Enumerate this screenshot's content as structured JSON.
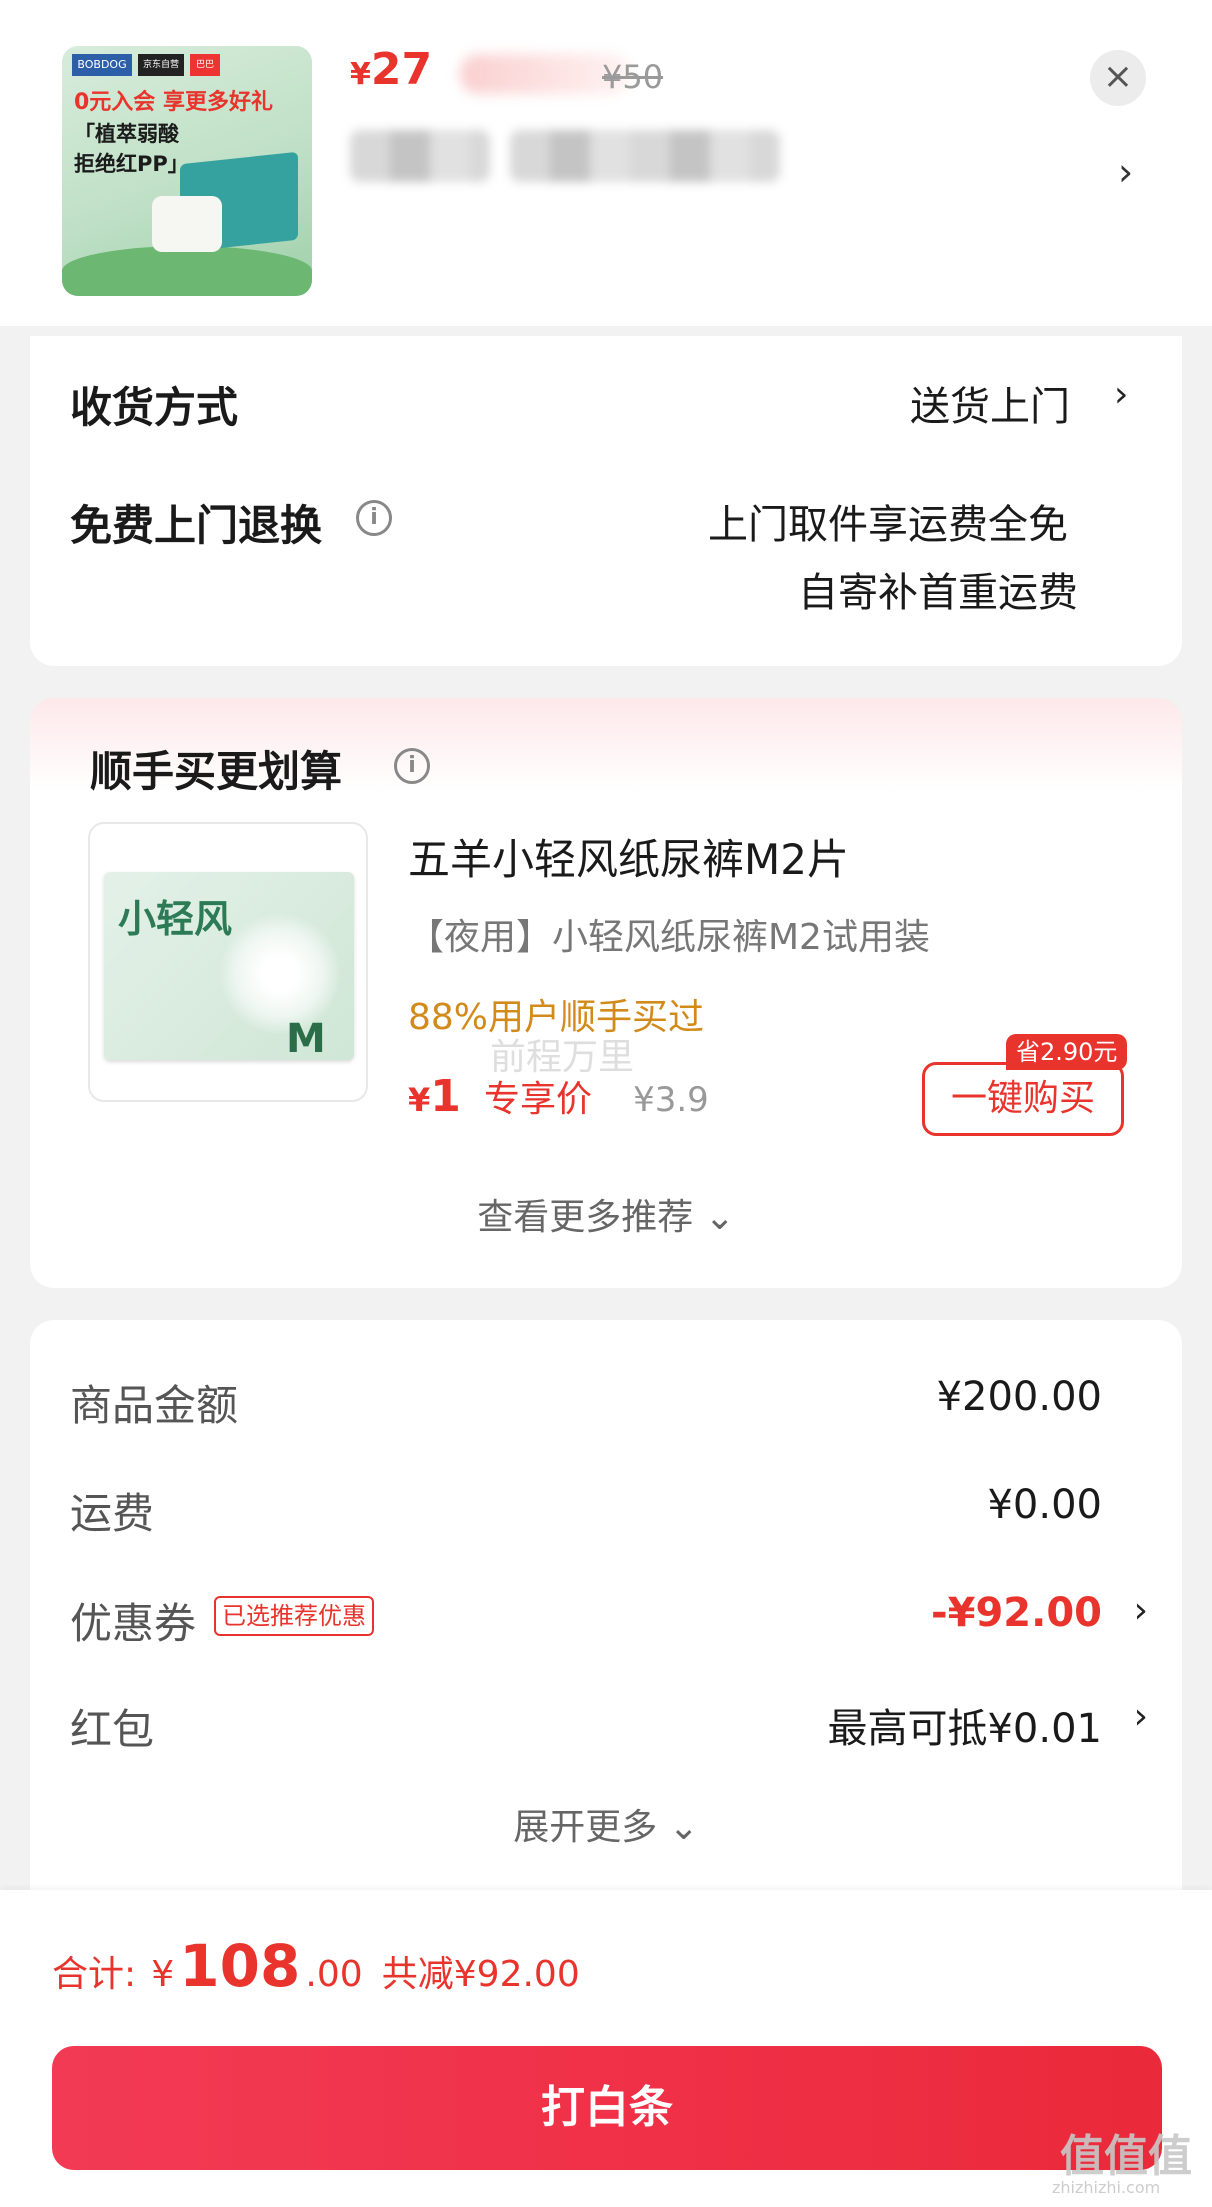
{
  "product": {
    "thumb_logo": "BOBDOG",
    "thumb_logo2": "京东自营",
    "thumb_logo3": "巴巴",
    "thumb_line1": "0元入会 享更多好礼",
    "thumb_line2": "「植萃弱酸",
    "thumb_line3": "拒绝红PP」",
    "yen": "¥",
    "price": "27",
    "original_price": "¥50",
    "close": "×",
    "chevron": "›"
  },
  "delivery": {
    "method_label": "收货方式",
    "method_value": "送货上门",
    "return_label": "免费上门退换",
    "return_value_line1": "上门取件享运费全免",
    "return_value_line2": "自寄补首重运费",
    "info": "i",
    "chevron": "›"
  },
  "recommend": {
    "title": "顺手买更划算",
    "info": "i",
    "pack_text": "小轻风",
    "pack_size": "M",
    "name": "五羊小轻风纸尿裤M2片",
    "desc": "【夜用】小轻风纸尿裤M2试用装",
    "stat": "88%用户顺手买过",
    "watermark": "前程万里",
    "yen": "¥",
    "price": "1",
    "price_tag": "专享价",
    "original_price": "¥3.9",
    "save_badge": "省2.90元",
    "buy_button": "一键购买",
    "more": "查看更多推荐 ⌄"
  },
  "summary": {
    "rows": [
      {
        "label": "商品金额",
        "value": "¥200.00"
      },
      {
        "label": "运费",
        "value": "¥0.00"
      },
      {
        "label": "优惠券",
        "value": "-¥92.00",
        "tag": "已选推荐优惠"
      },
      {
        "label": "红包",
        "value": "最高可抵¥0.01"
      }
    ],
    "chevron": "›",
    "expand": "展开更多 ⌄"
  },
  "footer": {
    "total_label": "合计:",
    "yen": "¥",
    "total_int": "108",
    "total_dec": ".00",
    "saved": "共减¥92.00",
    "pay_button": "打白条"
  },
  "watermark": {
    "site": "值值值",
    "site_sub": "zhizhizhi.com"
  },
  "colors": {
    "accent": "#e8342c",
    "pay_button": "#f23a55",
    "stat_orange": "#d28b1b"
  }
}
